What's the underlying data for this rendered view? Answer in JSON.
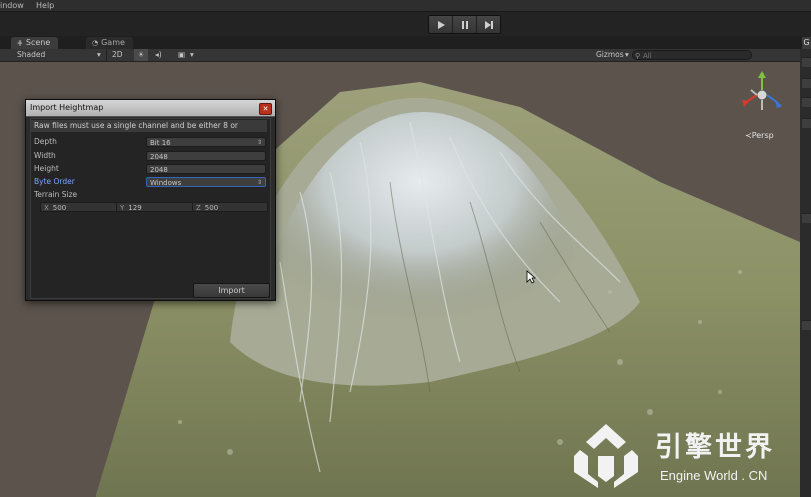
{
  "menubar": {
    "items": [
      "indow",
      "Help"
    ]
  },
  "toolbar": {
    "play_controls": [
      "play-icon",
      "pause-icon",
      "step-icon"
    ]
  },
  "tabs": [
    {
      "label": "Scene",
      "icon": "scene-icon",
      "active": true
    },
    {
      "label": "Game",
      "icon": "pacman-icon",
      "active": false
    }
  ],
  "scene_toolbar": {
    "shading_mode": "Shaded",
    "mode_2d": "2D",
    "gizmos": "Gizmos",
    "search_placeholder": "All"
  },
  "gizmo": {
    "projection": "Persp"
  },
  "dialog": {
    "title": "Import Heightmap",
    "message": "Raw files must use a single channel and be either 8 or",
    "fields": {
      "depth_label": "Depth",
      "depth_value": "Bit 16",
      "width_label": "Width",
      "width_value": "2048",
      "height_label": "Height",
      "height_value": "2048",
      "byte_order_label": "Byte Order",
      "byte_order_value": "Windows"
    },
    "terrain_size_label": "Terrain Size",
    "terrain_size": {
      "x_label": "X",
      "x": "500",
      "y_label": "Y",
      "y": "129",
      "z_label": "Z",
      "z": "500"
    },
    "import_label": "Import"
  },
  "watermark": {
    "title": "引擎世界",
    "url": "Engine World . CN"
  },
  "colors": {
    "gizmo_x": "#d9392b",
    "gizmo_y": "#7ec23f",
    "gizmo_z": "#3a77d8",
    "highlight_label": "#7aa6ff"
  }
}
